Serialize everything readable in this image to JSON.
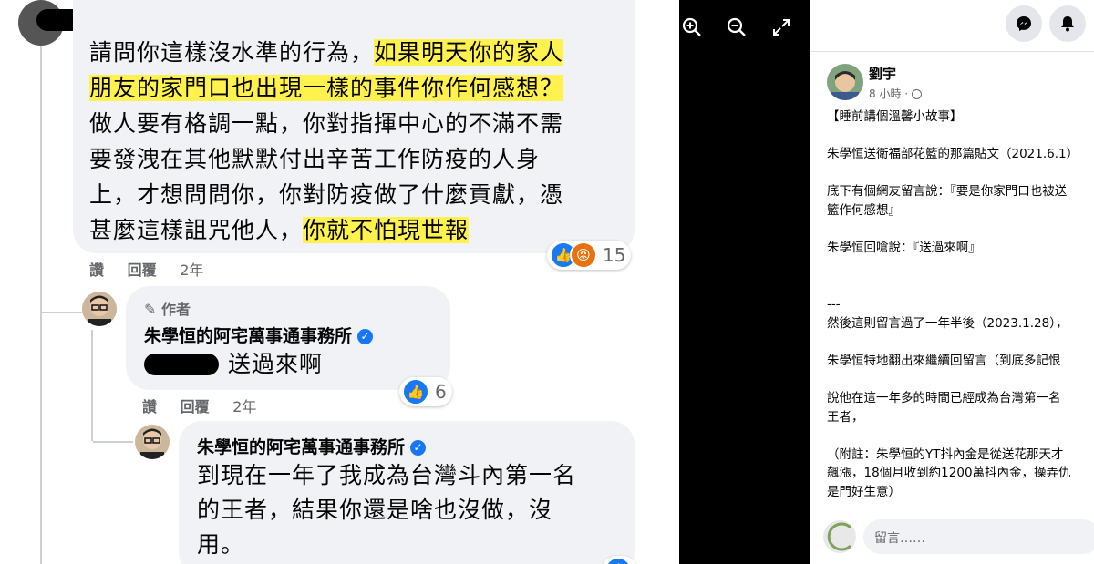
{
  "comment1": {
    "lines": [
      {
        "plain": "請問你這樣沒水準的行為，",
        "highlight": "如果明天你的家人"
      },
      {
        "plain": "",
        "highlight": "朋友的家門口也出現一樣的事件你作何感想？"
      },
      {
        "plain": "做人要有格調一點，你對指揮中心的不滿不需",
        "highlight": ""
      },
      {
        "plain": "要發洩在其他默默付出辛苦工作防疫的人身",
        "highlight": ""
      },
      {
        "plain": "上，才想問問你，你對防疫做了什麼貢獻，憑",
        "highlight": ""
      },
      {
        "plain": "甚麼這樣詛咒他人，",
        "highlight": "你就不怕現世報"
      }
    ],
    "actions": {
      "like": "讚",
      "reply": "回覆",
      "time": "2年"
    },
    "reaction_count": "15"
  },
  "reply1": {
    "author_tag": "作者",
    "name": "朱學恒的阿宅萬事通事務所",
    "text": "送過來啊",
    "actions": {
      "like": "讚",
      "reply": "回覆",
      "time": "2年"
    },
    "reaction_count": "6"
  },
  "reply2": {
    "name": "朱學恒的阿宅萬事通事務所",
    "lines": [
      "到現在一年了我成為台灣斗內第一名",
      "的王者，結果你還是啥也沒做，沒",
      "用。"
    ]
  },
  "viewer": {
    "zoom_in_icon": "zoom-in-icon",
    "zoom_out_icon": "zoom-out-icon",
    "fullscreen_icon": "fullscreen-icon"
  },
  "post": {
    "author": "劉宇",
    "time": "8 小時 · ",
    "lines": [
      "【睡前講個溫馨小故事】",
      "",
      "朱學恒送衛福部花籃的那篇貼文（2021.6.1）",
      "",
      "底下有個網友留言說：『要是你家門口也被送",
      "籃作何感想』",
      "",
      "朱學恒回嗆說：『送過來啊』",
      "",
      "",
      "---",
      "然後這則留言過了一年半後（2023.1.28），",
      "",
      "朱學恒特地翻出來繼續回留言（到底多記恨",
      "",
      "說他在這一年多的時間已經成為台灣第一名",
      "王者，",
      "",
      "（附註：朱學恒的YT抖內金是從送花那天才",
      "飆漲，18個月收到約1200萬抖內金，操弄仇",
      "是門好生意）"
    ],
    "comment_placeholder": "留言……"
  },
  "colors": {
    "highlight": "#fff24f",
    "like": "#1877f2",
    "angry": "#e9710f",
    "bubble": "#f0f2f5"
  }
}
